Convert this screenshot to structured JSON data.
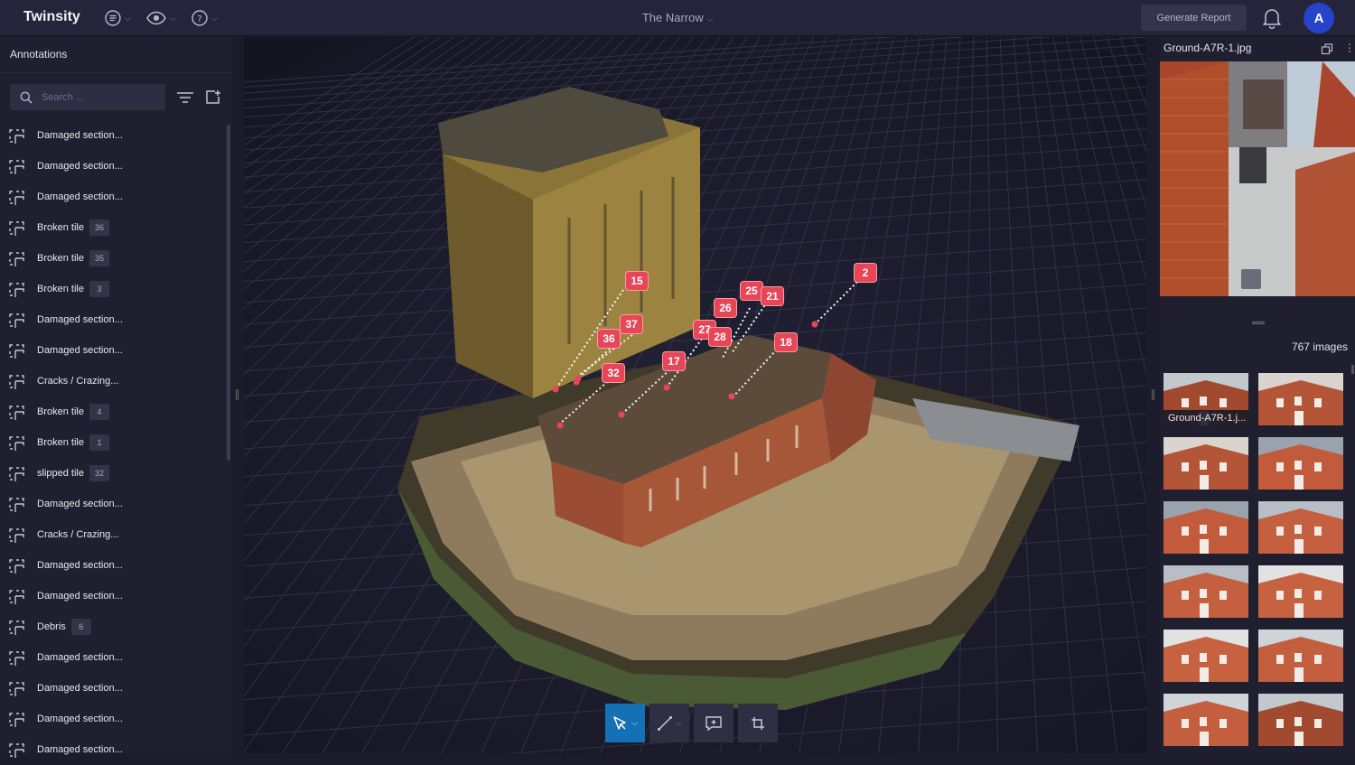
{
  "app": {
    "brand": "Twinsity",
    "project": "The Narrow"
  },
  "header": {
    "generate_report": "Generate Report",
    "avatar_initial": "A"
  },
  "annotations": {
    "title": "Annotations",
    "search_placeholder": "Search ...",
    "items": [
      {
        "label": "Damaged section...",
        "badge": ""
      },
      {
        "label": "Damaged section...",
        "badge": ""
      },
      {
        "label": "Damaged section...",
        "badge": ""
      },
      {
        "label": "Broken tile",
        "badge": "36"
      },
      {
        "label": "Broken tile",
        "badge": "35"
      },
      {
        "label": "Broken tile",
        "badge": "3"
      },
      {
        "label": "Damaged section...",
        "badge": ""
      },
      {
        "label": "Damaged section...",
        "badge": ""
      },
      {
        "label": "Cracks / Crazing...",
        "badge": ""
      },
      {
        "label": "Broken tile",
        "badge": "4"
      },
      {
        "label": "Broken tile",
        "badge": "1"
      },
      {
        "label": "slipped tile",
        "badge": "32"
      },
      {
        "label": "Damaged section...",
        "badge": ""
      },
      {
        "label": "Cracks / Crazing...",
        "badge": ""
      },
      {
        "label": "Damaged section...",
        "badge": ""
      },
      {
        "label": "Damaged section...",
        "badge": ""
      },
      {
        "label": "Debris",
        "badge": "6"
      },
      {
        "label": "Damaged section...",
        "badge": ""
      },
      {
        "label": "Damaged section...",
        "badge": ""
      },
      {
        "label": "Damaged section...",
        "badge": ""
      },
      {
        "label": "Damaged section...",
        "badge": ""
      }
    ]
  },
  "viewer": {
    "pins": [
      "15",
      "37",
      "36",
      "32",
      "17",
      "27",
      "28",
      "26",
      "25",
      "21",
      "18",
      "2"
    ]
  },
  "image_panel": {
    "filename": "Ground-A7R-1.jpg",
    "image_count": "767 images",
    "thumb_caption": "Ground-A7R-1.j..."
  },
  "colors": {
    "accent": "#1471b6",
    "pin": "#e64657",
    "avatar": "#2743c9"
  }
}
